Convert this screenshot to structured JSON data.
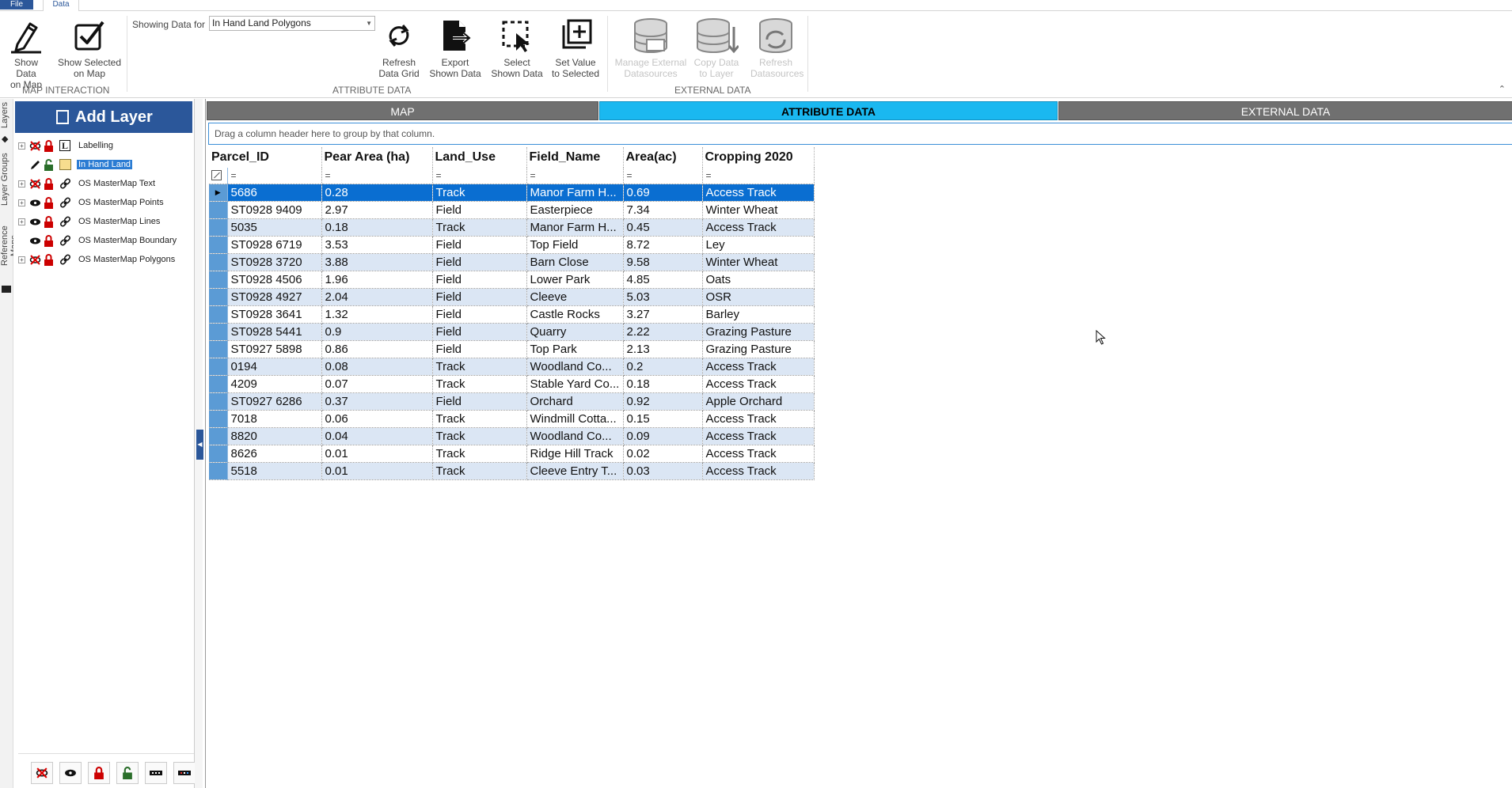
{
  "menu": {
    "file": "File",
    "data": "Data"
  },
  "ribbon": {
    "map_interaction": {
      "label": "MAP INTERACTION",
      "show_data_on_map": [
        "Show Data",
        "on Map"
      ],
      "show_selected_on_map": [
        "Show Selected",
        "on Map"
      ]
    },
    "showing_data_for": {
      "label": "Showing Data for",
      "value": "In Hand Land Polygons"
    },
    "attribute_data": {
      "label": "ATTRIBUTE DATA",
      "refresh": [
        "Refresh",
        "Data Grid"
      ],
      "export": [
        "Export",
        "Shown Data"
      ],
      "select": [
        "Select",
        "Shown Data"
      ],
      "set_value": [
        "Set Value",
        "to Selected"
      ]
    },
    "external_data": {
      "label": "EXTERNAL DATA",
      "manage": [
        "Manage External",
        "Datasources"
      ],
      "copy": [
        "Copy Data",
        "to Layer"
      ],
      "refresh": [
        "Refresh",
        "Datasources"
      ]
    }
  },
  "vertical_tabs": [
    "Layers",
    "Layer Groups",
    "Reference Maps"
  ],
  "layers_panel": {
    "add_layer": "Add Layer",
    "layers": [
      {
        "name": "Labelling",
        "visible": false,
        "locked": true,
        "selected": false,
        "expandable": true
      },
      {
        "name": "In Hand Land",
        "visible": true,
        "locked": false,
        "selected": true,
        "expandable": false
      },
      {
        "name": "OS MasterMap Text",
        "visible": false,
        "locked": true,
        "selected": false,
        "expandable": true
      },
      {
        "name": "OS MasterMap Points",
        "visible": true,
        "locked": true,
        "selected": false,
        "expandable": true
      },
      {
        "name": "OS MasterMap Lines",
        "visible": true,
        "locked": true,
        "selected": false,
        "expandable": true
      },
      {
        "name": "OS MasterMap Boundary",
        "visible": true,
        "locked": true,
        "selected": false,
        "expandable": false
      },
      {
        "name": "OS MasterMap Polygons",
        "visible": false,
        "locked": true,
        "selected": false,
        "expandable": true
      }
    ]
  },
  "main_tabs": [
    "MAP",
    "ATTRIBUTE DATA",
    "EXTERNAL DATA"
  ],
  "active_tab": "ATTRIBUTE DATA",
  "group_bar_hint": "Drag a column header here to group by that column.",
  "grid": {
    "columns": [
      "Parcel_ID",
      "Pear Area (ha)",
      "Land_Use",
      "Field_Name",
      "Area(ac)",
      "Cropping 2020"
    ],
    "filter_symbol": "=",
    "rows": [
      [
        "5686",
        "0.28",
        "Track",
        "Manor Farm H...",
        "0.69",
        "Access Track"
      ],
      [
        "ST0928 9409",
        "2.97",
        "Field",
        "Easterpiece",
        "7.34",
        "Winter Wheat"
      ],
      [
        "5035",
        "0.18",
        "Track",
        "Manor Farm H...",
        "0.45",
        "Access Track"
      ],
      [
        "ST0928 6719",
        "3.53",
        "Field",
        "Top Field",
        "8.72",
        "Ley"
      ],
      [
        "ST0928 3720",
        "3.88",
        "Field",
        "Barn Close",
        "9.58",
        "Winter Wheat"
      ],
      [
        "ST0928 4506",
        "1.96",
        "Field",
        "Lower Park",
        "4.85",
        "Oats"
      ],
      [
        "ST0928 4927",
        "2.04",
        "Field",
        "Cleeve",
        "5.03",
        "OSR"
      ],
      [
        "ST0928 3641",
        "1.32",
        "Field",
        "Castle Rocks",
        "3.27",
        "Barley"
      ],
      [
        "ST0928 5441",
        "0.9",
        "Field",
        "Quarry",
        "2.22",
        "Grazing Pasture"
      ],
      [
        "ST0927 5898",
        "0.86",
        "Field",
        "Top Park",
        "2.13",
        "Grazing Pasture"
      ],
      [
        "0194",
        "0.08",
        "Track",
        "Woodland Co...",
        "0.2",
        "Access Track"
      ],
      [
        "4209",
        "0.07",
        "Track",
        "Stable Yard Co...",
        "0.18",
        "Access Track"
      ],
      [
        "ST0927 6286",
        "0.37",
        "Field",
        "Orchard",
        "0.92",
        "Apple Orchard"
      ],
      [
        "7018",
        "0.06",
        "Track",
        "Windmill Cotta...",
        "0.15",
        "Access Track"
      ],
      [
        "8820",
        "0.04",
        "Track",
        "Woodland Co...",
        "0.09",
        "Access Track"
      ],
      [
        "8626",
        "0.01",
        "Track",
        "Ridge Hill Track",
        "0.02",
        "Access Track"
      ],
      [
        "5518",
        "0.01",
        "Track",
        "Cleeve Entry T...",
        "0.03",
        "Access Track"
      ]
    ],
    "selected_row": 0
  },
  "colors": {
    "accent": "#2b579a",
    "active_tab": "#1ab8f0",
    "row_selected": "#0a6ed1",
    "row_alt": "#dbe6f4"
  }
}
